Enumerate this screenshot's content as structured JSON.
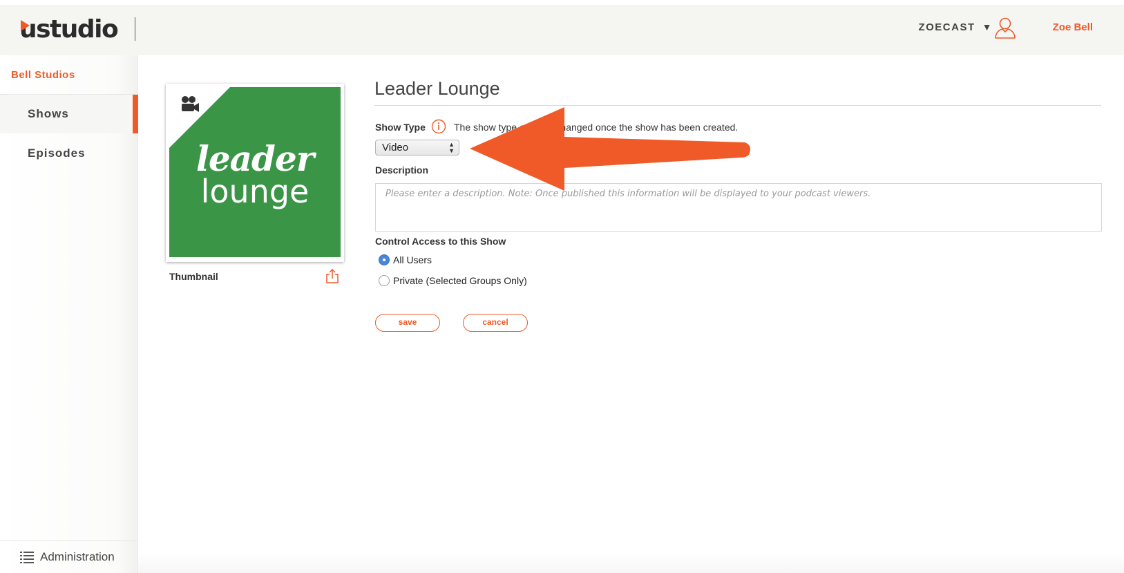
{
  "header": {
    "logo_text": "ustudio",
    "org_name": "ZOECAST",
    "org_caret": "▼",
    "user_name": "Zoe Bell"
  },
  "sidebar": {
    "studio_name": "Bell Studios",
    "items": [
      {
        "label": "Shows",
        "active": true
      },
      {
        "label": "Episodes",
        "active": false
      }
    ],
    "admin_label": "Administration"
  },
  "thumbnail": {
    "image_text_line1": "leader",
    "image_text_line2": "lounge",
    "label": "Thumbnail",
    "bg_color": "#3a9646"
  },
  "form": {
    "title": "Leader Lounge",
    "show_type_label": "Show Type",
    "show_type_info": "The show type can't be changed once the show has been created.",
    "show_type_value": "Video",
    "description_label": "Description",
    "description_placeholder": "Please enter a description. Note: Once published this information will be displayed to your podcast viewers.",
    "access_label": "Control Access to this Show",
    "access_options": [
      {
        "label": "All Users",
        "checked": true
      },
      {
        "label": "Private (Selected Groups Only)",
        "checked": false
      }
    ],
    "save_label": "save",
    "cancel_label": "cancel"
  },
  "colors": {
    "accent": "#f05a28",
    "radio_selected": "#4a86d8"
  },
  "annotation": {
    "type": "arrow",
    "color": "#f05a28",
    "points_to": "show-type-select"
  }
}
